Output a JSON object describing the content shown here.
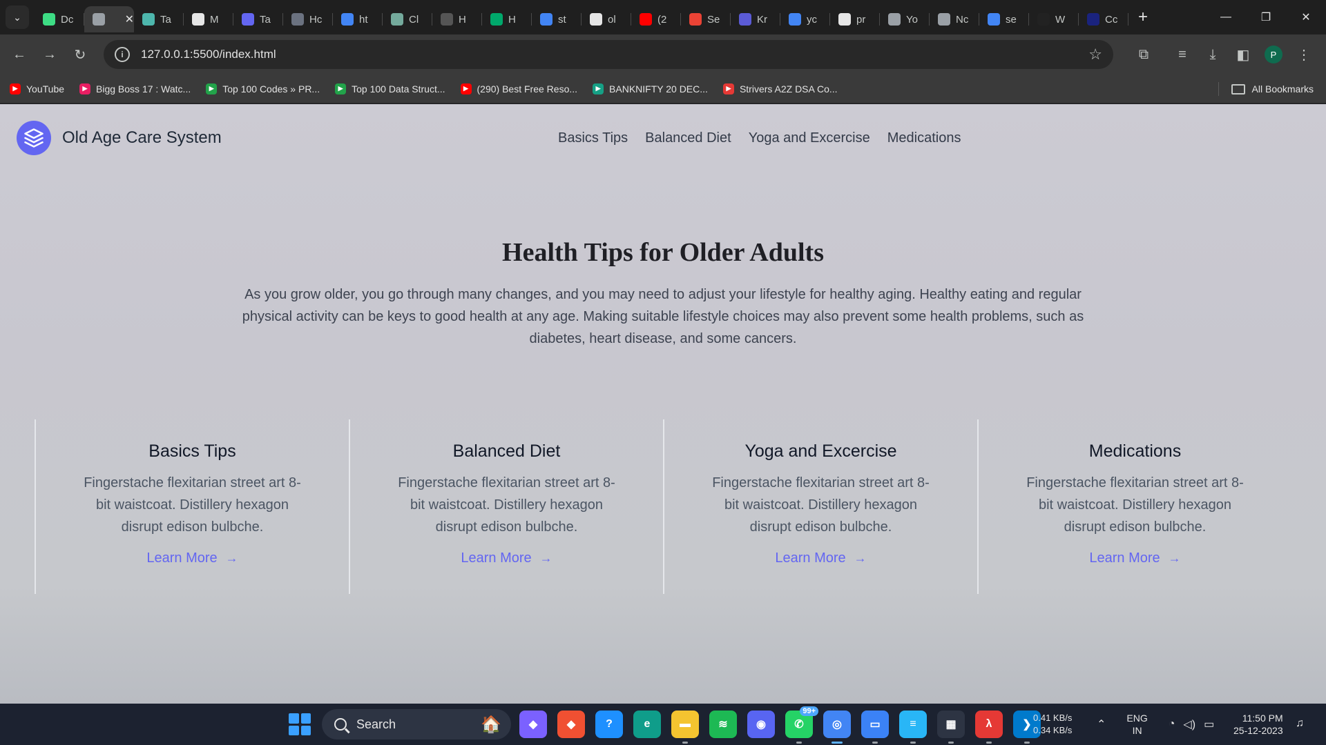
{
  "browser": {
    "tabs": [
      {
        "label": "Dc",
        "color": "#3ddc84",
        "icon": "android-icon"
      },
      {
        "label": "",
        "color": "#9aa0a6",
        "icon": "globe-icon",
        "active": true
      },
      {
        "label": "Ta",
        "color": "#4db6ac",
        "icon": "sheet-icon"
      },
      {
        "label": "M",
        "color": "#e6e6e6",
        "icon": "github-icon"
      },
      {
        "label": "Ta",
        "color": "#6366f1",
        "icon": "layers-icon"
      },
      {
        "label": "Hc",
        "color": "#6b7280",
        "icon": "arrow-icon"
      },
      {
        "label": "ht",
        "color": "#4285f4",
        "icon": "google-icon"
      },
      {
        "label": "Cl",
        "color": "#74aa9c",
        "icon": "chatgpt-icon"
      },
      {
        "label": "H",
        "color": "#555555",
        "icon": "tower-icon"
      },
      {
        "label": "H",
        "color": "#00a86b",
        "icon": "w3-icon"
      },
      {
        "label": "st",
        "color": "#4285f4",
        "icon": "google-icon"
      },
      {
        "label": "ol",
        "color": "#e6e6e6",
        "icon": "github-icon"
      },
      {
        "label": "(2",
        "color": "#ff0000",
        "icon": "youtube-icon"
      },
      {
        "label": "Se",
        "color": "#ea4335",
        "icon": "gmail-icon"
      },
      {
        "label": "Kr",
        "color": "#5b5bd6",
        "icon": "list-icon"
      },
      {
        "label": "yc",
        "color": "#4285f4",
        "icon": "google-icon"
      },
      {
        "label": "pr",
        "color": "#e6e6e6",
        "icon": "github-icon"
      },
      {
        "label": "Yo",
        "color": "#9aa0a6",
        "icon": "globe-icon"
      },
      {
        "label": "Nc",
        "color": "#9aa0a6",
        "icon": "chrome-icon"
      },
      {
        "label": "se",
        "color": "#4285f4",
        "icon": "google-icon"
      },
      {
        "label": "W",
        "color": "#222222",
        "icon": "castle-icon"
      },
      {
        "label": "Cc",
        "color": "#1a237e",
        "icon": "dot-icon"
      }
    ],
    "url": "127.0.0.1:5500/index.html",
    "bookmarks": [
      {
        "label": "YouTube",
        "color": "#ff0000"
      },
      {
        "label": "Bigg Boss 17 : Watc...",
        "color": "#e91e63"
      },
      {
        "label": "Top 100 Codes » PR...",
        "color": "#22a34a"
      },
      {
        "label": "Top 100 Data Struct...",
        "color": "#22a34a"
      },
      {
        "label": "(290) Best Free Reso...",
        "color": "#ff0000"
      },
      {
        "label": "BANKNIFTY 20 DEC...",
        "color": "#16a085"
      },
      {
        "label": "Strivers A2Z DSA Co...",
        "color": "#e53935"
      }
    ],
    "all_bookmarks": "All Bookmarks",
    "profile_initial": "P"
  },
  "site": {
    "title": "Old Age Care System",
    "nav": [
      "Basics Tips",
      "Balanced Diet",
      "Yoga and Excercise",
      "Medications"
    ],
    "hero_title": "Health Tips for Older Adults",
    "hero_text": "As you grow older, you go through many changes, and you may need to adjust your lifestyle for healthy aging. Healthy eating and regular physical activity can be keys to good health at any age. Making suitable lifestyle choices may also prevent some health problems, such as diabetes, heart disease, and some cancers.",
    "cards": [
      {
        "title": "Basics Tips",
        "text": "Fingerstache flexitarian street art 8-bit waistcoat. Distillery hexagon disrupt edison bulbche.",
        "link": "Learn More"
      },
      {
        "title": "Balanced Diet",
        "text": "Fingerstache flexitarian street art 8-bit waistcoat. Distillery hexagon disrupt edison bulbche.",
        "link": "Learn More"
      },
      {
        "title": "Yoga and Excercise",
        "text": "Fingerstache flexitarian street art 8-bit waistcoat. Distillery hexagon disrupt edison bulbche.",
        "link": "Learn More"
      },
      {
        "title": "Medications",
        "text": "Fingerstache flexitarian street art 8-bit waistcoat. Distillery hexagon disrupt edison bulbche.",
        "link": "Learn More"
      }
    ],
    "accent": "#6366f1"
  },
  "taskbar": {
    "search_label": "Search",
    "whatsapp_badge": "99+",
    "net_up": "0.41 KB/s",
    "net_down": "0.34 KB/s",
    "lang": "ENG",
    "region": "IN",
    "time": "11:50 PM",
    "date": "25-12-2023",
    "apps": [
      {
        "name": "copilot-icon",
        "color": "#7b61ff",
        "glyph": "◆"
      },
      {
        "name": "git-icon",
        "color": "#f05032",
        "glyph": "◆"
      },
      {
        "name": "help-icon",
        "color": "#1e90ff",
        "glyph": "?"
      },
      {
        "name": "edge-icon",
        "color": "#0f9d8a",
        "glyph": "e"
      },
      {
        "name": "file-explorer-icon",
        "color": "#f4c430",
        "glyph": "▬"
      },
      {
        "name": "spotify-icon",
        "color": "#1db954",
        "glyph": "≋"
      },
      {
        "name": "discord-icon",
        "color": "#5865f2",
        "glyph": "◉"
      },
      {
        "name": "whatsapp-icon",
        "color": "#25d366",
        "glyph": "✆"
      },
      {
        "name": "chrome-icon",
        "color": "#4285f4",
        "glyph": "◎"
      },
      {
        "name": "monitor-icon",
        "color": "#3b82f6",
        "glyph": "▭"
      },
      {
        "name": "notepad-icon",
        "color": "#29b6f6",
        "glyph": "≡"
      },
      {
        "name": "store-icon",
        "color": "#2d3443",
        "glyph": "▦"
      },
      {
        "name": "pdf-icon",
        "color": "#e53935",
        "glyph": "λ"
      },
      {
        "name": "vscode-icon",
        "color": "#007acc",
        "glyph": "❯"
      }
    ]
  }
}
